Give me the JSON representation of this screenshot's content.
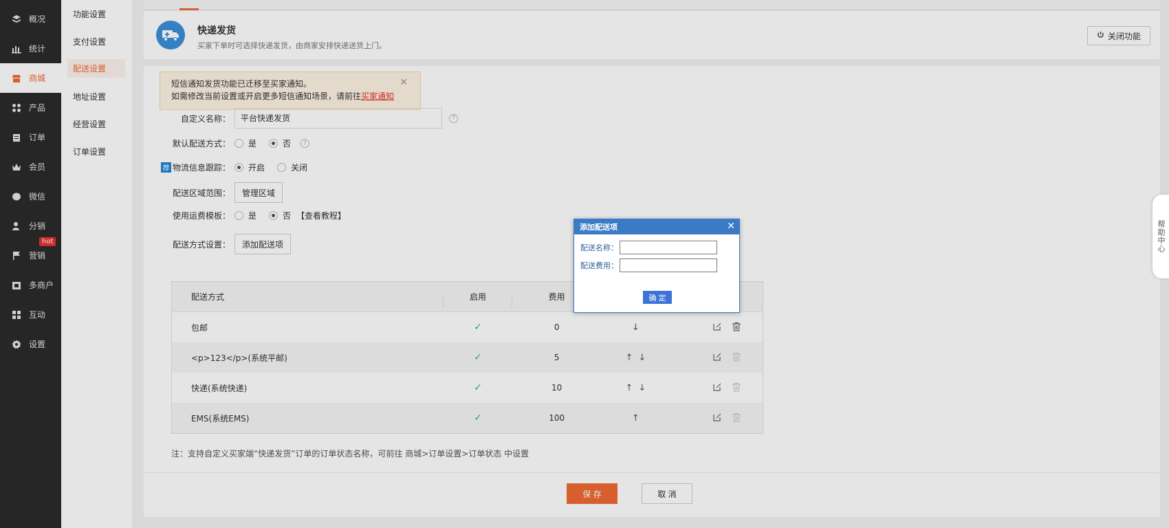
{
  "sidebar": {
    "items": [
      {
        "label": "概况",
        "icon": "layers-icon"
      },
      {
        "label": "统计",
        "icon": "chart-icon"
      },
      {
        "label": "商城",
        "icon": "shop-icon",
        "active": true
      },
      {
        "label": "产品",
        "icon": "grid-icon"
      },
      {
        "label": "订单",
        "icon": "clipboard-icon"
      },
      {
        "label": "会员",
        "icon": "crown-icon"
      },
      {
        "label": "微信",
        "icon": "wechat-icon"
      },
      {
        "label": "分销",
        "icon": "user-share-icon"
      },
      {
        "label": "营销",
        "icon": "flag-icon",
        "badge": "hot"
      },
      {
        "label": "多商户",
        "icon": "store-icon"
      },
      {
        "label": "互动",
        "icon": "apps-icon"
      },
      {
        "label": "设置",
        "icon": "gear-icon"
      }
    ]
  },
  "subnav": {
    "items": [
      "功能设置",
      "支付设置",
      "配送设置",
      "地址设置",
      "经营设置",
      "订单设置"
    ],
    "active_index": 2
  },
  "header": {
    "title": "快递发货",
    "description": "买家下单时可选择快递发货，由商家安排快递送货上门。",
    "close_button": "关闭功能"
  },
  "notice": {
    "line1": "短信通知发货功能已迁移至买家通知。",
    "line2_prefix": "如需修改当前设置或开启更多短信通知场景，请前往",
    "link": "买家通知"
  },
  "form": {
    "custom_name_label": "自定义名称：",
    "custom_name_value": "平台快递发货",
    "default_method_label": "默认配送方式：",
    "yes": "是",
    "no": "否",
    "tracking_label": "物流信息跟踪：",
    "tracking_tag": "荐",
    "on": "开启",
    "off": "关闭",
    "area_label": "配送区域范围：",
    "area_button": "管理区域",
    "template_label": "使用运费模板：",
    "tutorial_link": "【查看教程】",
    "method_label": "配送方式设置：",
    "add_button": "添加配送项"
  },
  "table": {
    "headers": [
      "配送方式",
      "启用",
      "费用",
      "",
      ""
    ],
    "rows": [
      {
        "name": "包邮",
        "fee": "0",
        "up": false,
        "down": true,
        "deletable": true
      },
      {
        "name": "<p>123</p>(系统平邮)",
        "fee": "5",
        "up": true,
        "down": true,
        "deletable": false
      },
      {
        "name": "快递(系统快递)",
        "fee": "10",
        "up": true,
        "down": true,
        "deletable": false
      },
      {
        "name": "EMS(系统EMS)",
        "fee": "100",
        "up": true,
        "down": false,
        "deletable": false
      }
    ]
  },
  "note": "注：支持自定义买家端“快递发货”订单的订单状态名称，可前往 商城>订单设置>订单状态 中设置",
  "footer": {
    "save": "保 存",
    "cancel": "取 消"
  },
  "modal": {
    "title": "添加配送项",
    "name_label": "配送名称：",
    "fee_label": "配送费用：",
    "name_value": "",
    "fee_value": "",
    "confirm": "确 定"
  },
  "help_center": "帮助中心",
  "colors": {
    "accent": "#f06a35",
    "sidebar_bg": "#2b2b2b",
    "modal_header": "#3b7bc6"
  }
}
